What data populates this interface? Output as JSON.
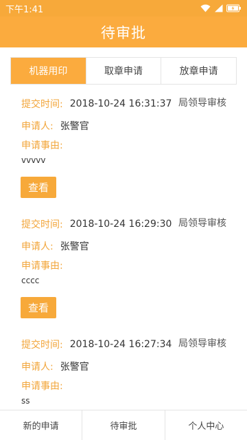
{
  "status_bar": {
    "time": "下午1:41",
    "icons": [
      "wifi-icon",
      "signal-icon",
      "battery-icon"
    ]
  },
  "header": {
    "title": "待审批"
  },
  "tabs": [
    {
      "label": "机器用印",
      "active": true
    },
    {
      "label": "取章申请",
      "active": false
    },
    {
      "label": "放章申请",
      "active": false
    }
  ],
  "labels": {
    "submit_time": "提交时间:",
    "applicant": "申请人:",
    "reason": "申请事由:",
    "view_button": "查看"
  },
  "records": [
    {
      "submit_time": "2018-10-24 16:31:37",
      "status": "局领导审核",
      "applicant": "张警官",
      "reason": "vvvvv"
    },
    {
      "submit_time": "2018-10-24 16:29:30",
      "status": "局领导审核",
      "applicant": "张警官",
      "reason": "cccc"
    },
    {
      "submit_time": "2018-10-24 16:27:34",
      "status": "局领导审核",
      "applicant": "张警官",
      "reason": "ss"
    }
  ],
  "bottom_nav": [
    {
      "label": "新的申请"
    },
    {
      "label": "待审批"
    },
    {
      "label": "个人中心"
    }
  ],
  "colors": {
    "accent": "#fbab3e",
    "label": "#f2a53a",
    "text": "#333333"
  }
}
